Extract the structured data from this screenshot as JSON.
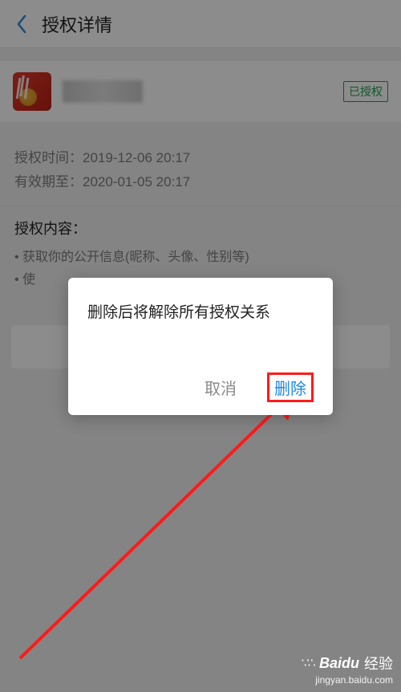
{
  "header": {
    "title": "授权详情"
  },
  "app": {
    "badge": "已授权"
  },
  "info": {
    "auth_time_label": "授权时间：",
    "auth_time_value": "2019-12-06 20:17",
    "expire_label": "有效期至：",
    "expire_value": "2020-01-05 20:17"
  },
  "scopes": {
    "title": "授权内容：",
    "items": [
      "获取你的公开信息(昵称、头像、性别等)",
      "使"
    ]
  },
  "dialog": {
    "message": "删除后将解除所有授权关系",
    "cancel": "取消",
    "delete": "删除"
  },
  "watermark": {
    "brand": "Baidu",
    "cn": "经验",
    "url": "jingyan.baidu.com"
  },
  "colors": {
    "accent": "#1e88e5",
    "danger_box": "#ff1a1a"
  }
}
